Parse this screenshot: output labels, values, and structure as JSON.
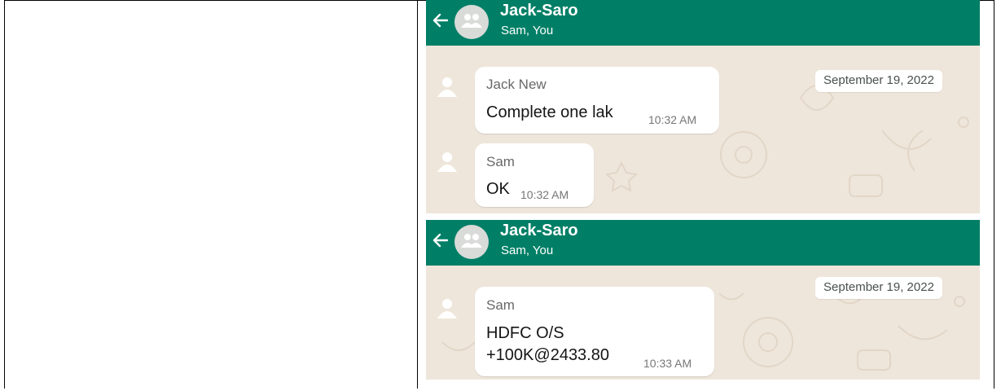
{
  "chat_screens": [
    {
      "header": {
        "group_name": "Jack-Saro",
        "members": "Sam, You"
      },
      "date": "September 19, 2022",
      "messages": [
        {
          "sender": "Jack New",
          "text": "Complete one lak",
          "time": "10:32 AM"
        },
        {
          "sender": "Sam",
          "text": "OK",
          "time": "10:32 AM"
        }
      ]
    },
    {
      "header": {
        "group_name": "Jack-Saro",
        "members": "Sam, You"
      },
      "date": "September 19, 2022",
      "messages": [
        {
          "sender": "Sam",
          "text": "HDFC O/S",
          "text_line2": "+100K@2433.80",
          "time": "10:33 AM"
        }
      ]
    }
  ],
  "colors": {
    "header_bg": "#007f66",
    "chat_bg": "#efe6db",
    "bubble_bg": "#ffffff",
    "avatar_bg": "#d9dbd9"
  },
  "icons": [
    "back-arrow-icon",
    "group-avatar-icon",
    "person-avatar-icon"
  ]
}
